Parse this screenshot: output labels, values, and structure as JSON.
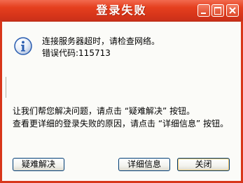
{
  "window": {
    "title": "登录失败"
  },
  "titlebar_buttons": {
    "minimize_icon": "minimize-icon",
    "maximize_icon": "maximize-icon",
    "close_icon": "close-icon"
  },
  "message": {
    "icon": "info-icon",
    "line1": "连接服务器超时，请检查网络。",
    "line2": "错误代码:115713"
  },
  "help": {
    "line1": "让我们帮您解决问题，请点击 “疑难解决” 按钮。",
    "line2": "查看更详细的登录失败的原因，请点击 “详细信息” 按钮。"
  },
  "buttons": {
    "troubleshoot": "疑难解决",
    "details": "详细信息",
    "close": "关闭"
  },
  "colors": {
    "titlebar": "#d8361a",
    "button_border": "#003c74",
    "info_icon": "#2a5db0"
  }
}
